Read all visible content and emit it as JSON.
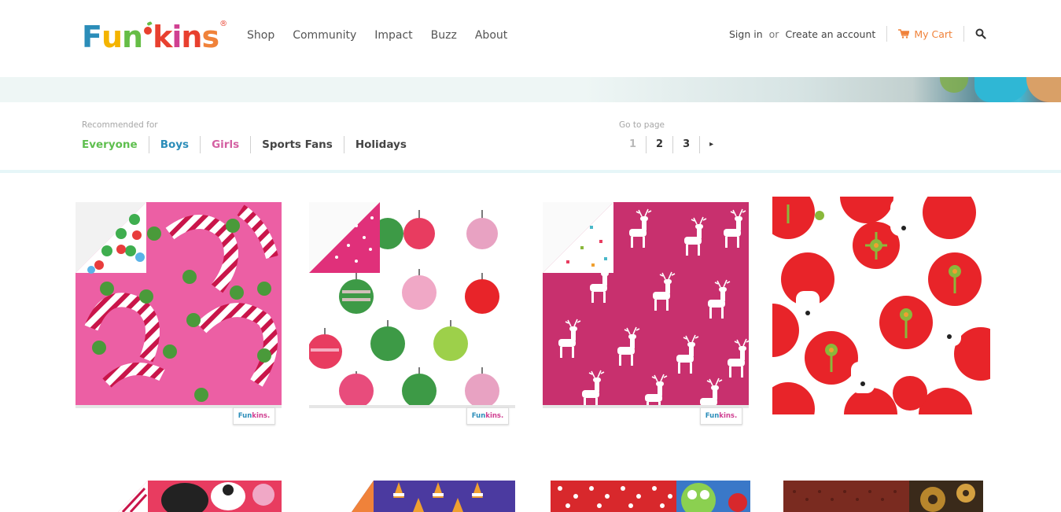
{
  "brand": {
    "logo_letters": [
      "F",
      "u",
      "n",
      "k",
      "i",
      "n",
      "s"
    ],
    "registered_mark": "®",
    "letter_colors": [
      "#2b8db9",
      "#f4b400",
      "#66bd46",
      "#e8402f",
      "#d04092",
      "#e8402f",
      "#f0823a"
    ]
  },
  "nav": {
    "items": [
      "Shop",
      "Community",
      "Impact",
      "Buzz",
      "About"
    ]
  },
  "account": {
    "sign_in": "Sign in",
    "or": "or",
    "create_account": "Create an account",
    "cart_label": "My Cart"
  },
  "filters": {
    "recommended_label": "Recommended for",
    "tabs": [
      "Everyone",
      "Boys",
      "Girls",
      "Sports Fans",
      "Holidays"
    ],
    "pager_label": "Go to page",
    "pages": [
      "1",
      "2",
      "3"
    ],
    "current_page": "1",
    "next_glyph": "▸"
  },
  "products": [
    {
      "name": "Pink candy cane print napkin",
      "tag": "Funkins.",
      "colors": {
        "base": "#ec5fa4",
        "accent": "#c9154a",
        "dot": "#4a9a3a"
      }
    },
    {
      "name": "Holiday ornament print napkin",
      "tag": "Funkins.",
      "colors": {
        "base": "#ffffff",
        "accent": "#e83c60",
        "dot": "#3d9a46"
      }
    },
    {
      "name": "Magenta reindeer print napkin",
      "tag": "Funkins.",
      "colors": {
        "base": "#c8306e",
        "accent": "#ffffff",
        "dot": "#49b8c9"
      }
    },
    {
      "name": "Polar bear and red circle print napkin",
      "tag": "",
      "colors": {
        "base": "#ffffff",
        "accent": "#e82429",
        "dot": "#8ab83b"
      }
    },
    {
      "name": "Penguin print napkin",
      "tag": "",
      "colors": {
        "base": "#e83c60",
        "accent": "#222222",
        "dot": "#ffffff"
      }
    },
    {
      "name": "Candy corn print napkin",
      "tag": "",
      "colors": {
        "base": "#4b3aa0",
        "accent": "#f0a030",
        "dot": "#ffffff"
      }
    },
    {
      "name": "Red polka dot print napkin",
      "tag": "",
      "colors": {
        "base": "#d8282c",
        "accent": "#ffffff",
        "dot": "#8bd050"
      }
    },
    {
      "name": "Brown gear print napkin",
      "tag": "",
      "colors": {
        "base": "#7a2b20",
        "accent": "#b8862c",
        "dot": "#3a2a1a"
      }
    }
  ]
}
